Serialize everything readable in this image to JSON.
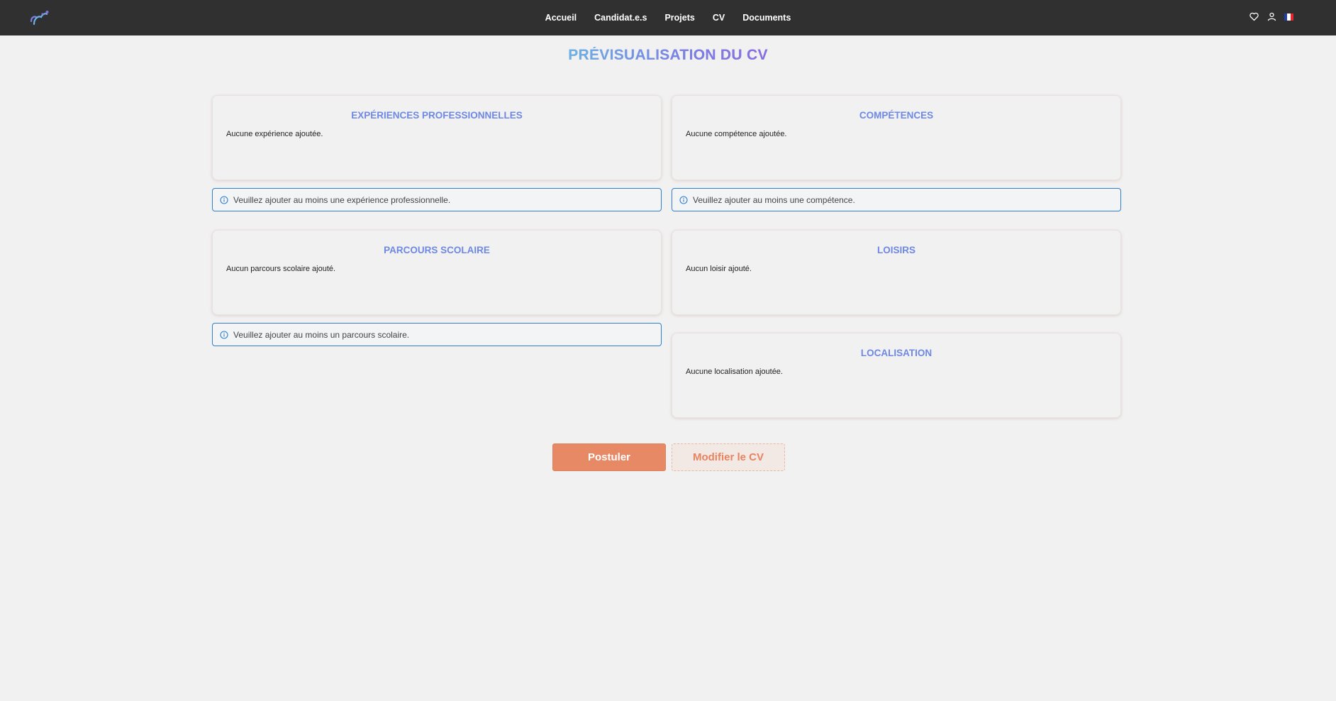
{
  "nav": {
    "links": [
      "Accueil",
      "Candidat.e.s",
      "Projets",
      "CV",
      "Documents"
    ],
    "icons": [
      "heart-icon",
      "user-icon",
      "french-flag-icon"
    ]
  },
  "page_title": "PRÉVISUALISATION DU CV",
  "sections": {
    "experiences": {
      "title": "EXPÉRIENCES PROFESSIONNELLES",
      "empty": "Aucune expérience ajoutée.",
      "alert": "Veuillez ajouter au moins une expérience professionnelle."
    },
    "competences": {
      "title": "COMPÉTENCES",
      "empty": "Aucune compétence ajoutée.",
      "alert": "Veuillez ajouter au moins une compétence."
    },
    "parcours": {
      "title": "PARCOURS SCOLAIRE",
      "empty": "Aucun parcours scolaire ajouté.",
      "alert": "Veuillez ajouter au moins un parcours scolaire."
    },
    "loisirs": {
      "title": "LOISIRS",
      "empty": "Aucun loisir ajouté."
    },
    "localisation": {
      "title": "LOCALISATION",
      "empty": "Aucune localisation ajoutée."
    }
  },
  "buttons": {
    "apply": "Postuler",
    "edit": "Modifier le CV"
  },
  "colors": {
    "navbar": "#303030",
    "accent_title": "#6e88e6",
    "alert_border": "#2f7fd0",
    "primary_button": "#e88965"
  }
}
